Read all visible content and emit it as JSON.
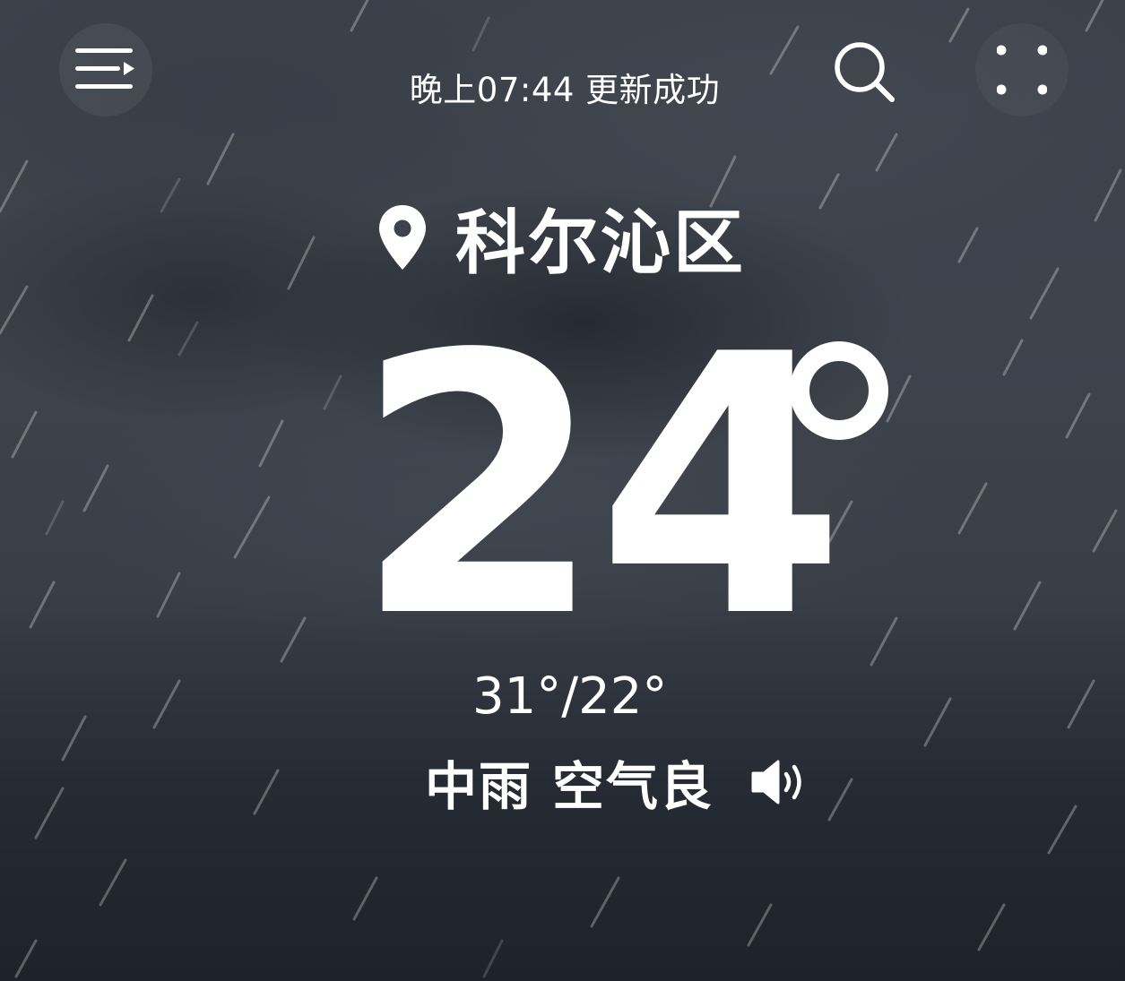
{
  "header": {
    "update_status": "晚上07:44 更新成功",
    "menu_icon": "menu-list-icon",
    "search_icon": "search-icon",
    "more_icon": "four-dots-icon"
  },
  "location": {
    "city": "科尔沁区",
    "icon": "location-pin-icon"
  },
  "current": {
    "temperature": "24",
    "temperature_unit": "°",
    "high_low": "31°/22°",
    "condition": "中雨",
    "air_quality": "空气良",
    "speaker_icon": "speaker-icon"
  },
  "colors": {
    "background_top": "#3f434c",
    "background_bottom": "#1e222a",
    "text": "#ffffff"
  }
}
